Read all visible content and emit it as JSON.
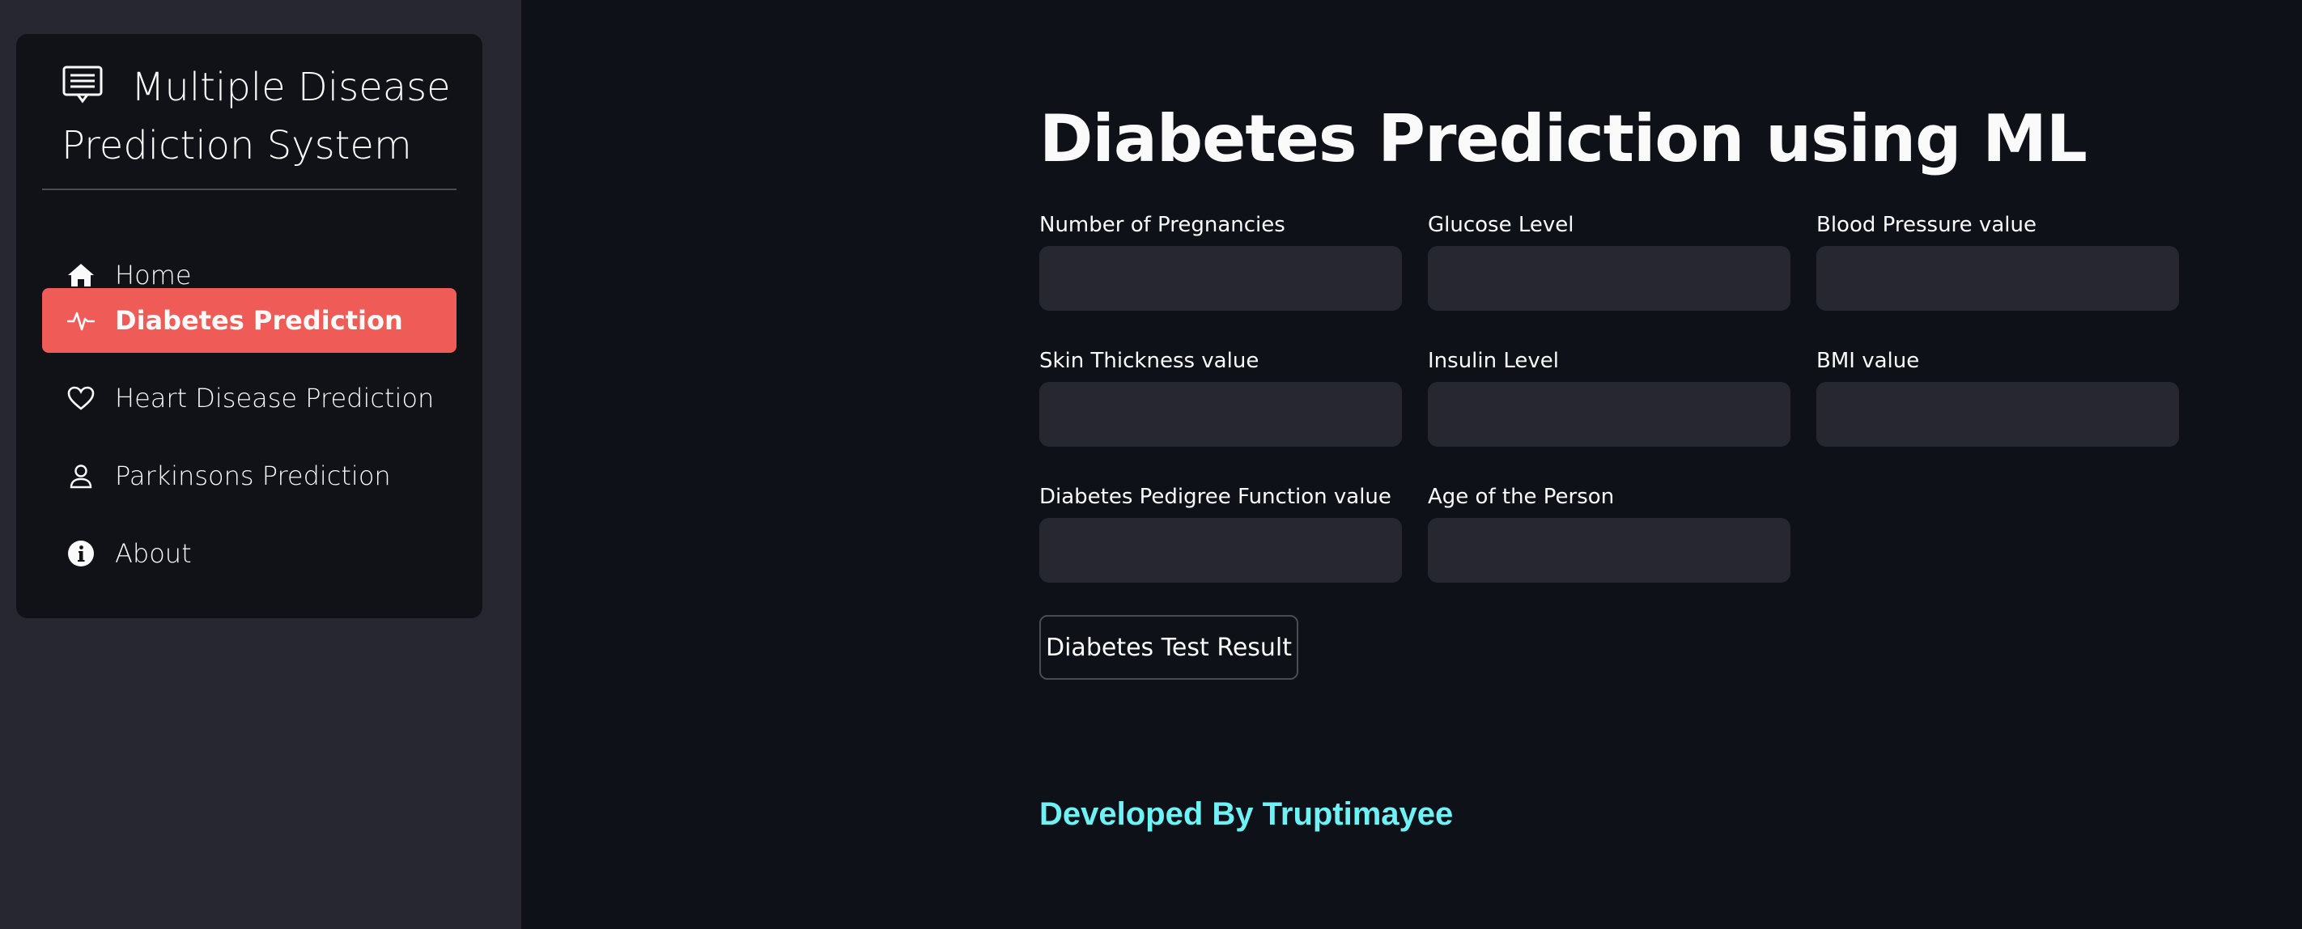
{
  "sidebar": {
    "menu_title": "Multiple Disease Prediction System",
    "title_icon": "list-card-icon",
    "items": [
      {
        "label": "Home",
        "icon": "house-icon",
        "active": false
      },
      {
        "label": "Diabetes Prediction",
        "icon": "heartbeat-icon",
        "active": true
      },
      {
        "label": "Heart Disease Prediction",
        "icon": "heart-icon",
        "active": false
      },
      {
        "label": "Parkinsons Prediction",
        "icon": "person-icon",
        "active": false
      },
      {
        "label": "About",
        "icon": "info-icon",
        "active": false
      }
    ],
    "active_color": "#ef5b56"
  },
  "main": {
    "title": "Diabetes Prediction using ML",
    "fields": [
      {
        "label": "Number of Pregnancies",
        "value": ""
      },
      {
        "label": "Glucose Level",
        "value": ""
      },
      {
        "label": "Blood Pressure value",
        "value": ""
      },
      {
        "label": "Skin Thickness value",
        "value": ""
      },
      {
        "label": "Insulin Level",
        "value": ""
      },
      {
        "label": "BMI value",
        "value": ""
      },
      {
        "label": "Diabetes Pedigree Function value",
        "value": ""
      },
      {
        "label": "Age of the Person",
        "value": ""
      }
    ],
    "button_label": "Diabetes Test Result",
    "footer": "Developed By Truptimayee",
    "footer_color": "#6ff2f6"
  }
}
